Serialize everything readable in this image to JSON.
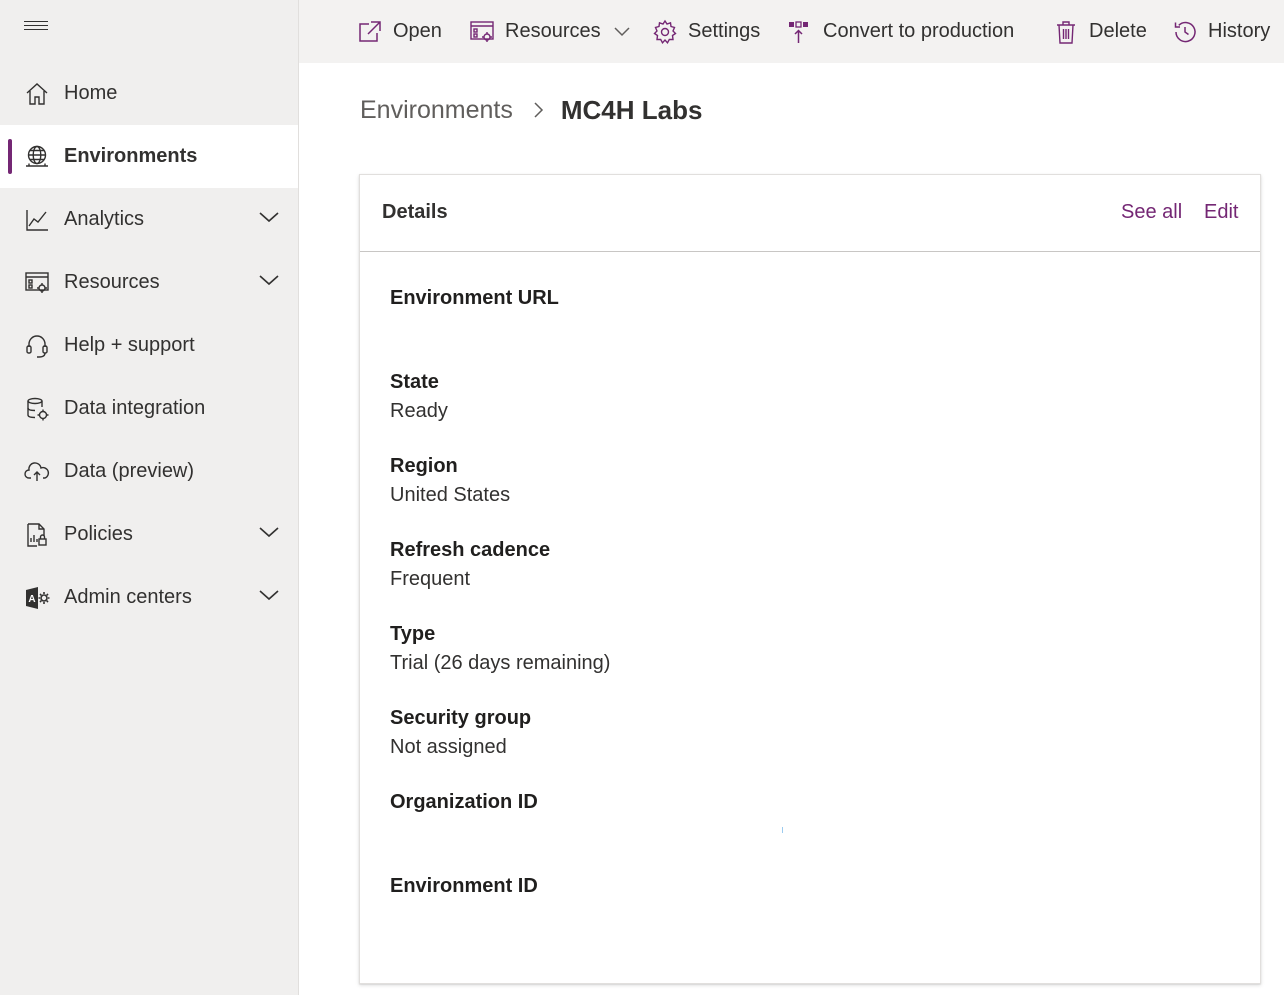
{
  "sidebar": {
    "items": [
      {
        "label": "Home",
        "icon": "home-icon",
        "active": false,
        "expandable": false
      },
      {
        "label": "Environments",
        "icon": "globe-icon",
        "active": true,
        "expandable": false
      },
      {
        "label": "Analytics",
        "icon": "analytics-icon",
        "active": false,
        "expandable": true
      },
      {
        "label": "Resources",
        "icon": "resources-icon",
        "active": false,
        "expandable": true
      },
      {
        "label": "Help + support",
        "icon": "headset-icon",
        "active": false,
        "expandable": false
      },
      {
        "label": "Data integration",
        "icon": "data-integration-icon",
        "active": false,
        "expandable": false
      },
      {
        "label": "Data (preview)",
        "icon": "cloud-data-icon",
        "active": false,
        "expandable": false
      },
      {
        "label": "Policies",
        "icon": "policies-icon",
        "active": false,
        "expandable": true
      },
      {
        "label": "Admin centers",
        "icon": "admin-centers-icon",
        "active": false,
        "expandable": true
      }
    ]
  },
  "toolbar": {
    "open": "Open",
    "resources": "Resources",
    "settings": "Settings",
    "convert": "Convert to production",
    "delete": "Delete",
    "history": "History"
  },
  "breadcrumb": {
    "parent": "Environments",
    "current": "MC4H Labs"
  },
  "details": {
    "title": "Details",
    "see_all": "See all",
    "edit": "Edit",
    "fields": [
      {
        "label": "Environment URL",
        "value": ""
      },
      {
        "label": "State",
        "value": "Ready"
      },
      {
        "label": "Region",
        "value": "United States"
      },
      {
        "label": "Refresh cadence",
        "value": "Frequent"
      },
      {
        "label": "Type",
        "value": "Trial (26 days remaining)"
      },
      {
        "label": "Security group",
        "value": "Not assigned"
      },
      {
        "label": "Organization ID",
        "value": ""
      },
      {
        "label": "Environment ID",
        "value": ""
      }
    ]
  },
  "colors": {
    "accent": "#742774",
    "sidebar_bg": "#f0efee",
    "toolbar_bg": "#f3f2f1"
  }
}
